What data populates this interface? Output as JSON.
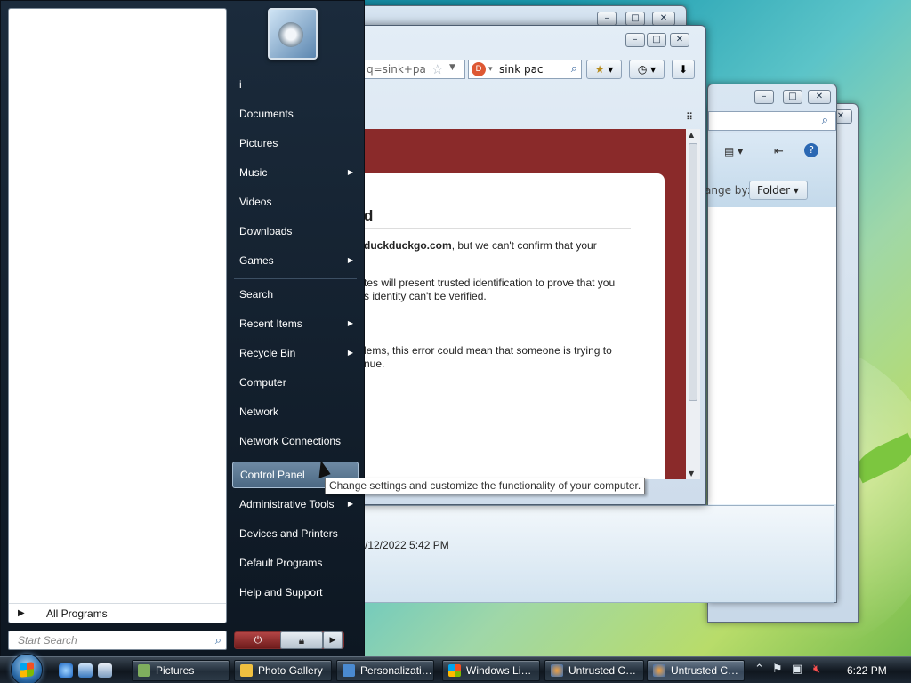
{
  "browser": {
    "address_fragment": "q=sink+pa",
    "search_text": "sink pac",
    "error": {
      "heading": "d",
      "line1_bold": "duckduckgo.com",
      "line1_rest": ", but we can't confirm that your",
      "line2": "tes will present trusted identification to prove that you",
      "line3": "s identity can't be verified.",
      "line4": "lems, this error could mean that someone is trying to",
      "line5": "nue."
    }
  },
  "folder_window": {
    "arrange_by_label": "ange by:",
    "arrange_by_value": "Folder",
    "date_modified": "/12/2022 5:42 PM"
  },
  "start_menu": {
    "user_letter": "i",
    "right_items": [
      {
        "label": "Documents"
      },
      {
        "label": "Pictures"
      },
      {
        "label": "Music"
      },
      {
        "label": "Videos"
      },
      {
        "label": "Downloads"
      },
      {
        "label": "Games"
      },
      {
        "label": "Search"
      },
      {
        "label": "Recent Items"
      },
      {
        "label": "Recycle Bin"
      },
      {
        "label": "Computer"
      },
      {
        "label": "Network"
      },
      {
        "label": "Network Connections"
      },
      {
        "label": "Control Panel"
      },
      {
        "label": "Administrative Tools"
      },
      {
        "label": "Devices and Printers"
      },
      {
        "label": "Default Programs"
      },
      {
        "label": "Help and Support"
      }
    ],
    "all_programs": "All Programs",
    "search_placeholder": "Start Search"
  },
  "tooltip": "Change settings and customize the functionality of your computer.",
  "taskbar": {
    "tasks": [
      {
        "label": "Pictures",
        "icon": "folder-icon",
        "color": "#7fae5e"
      },
      {
        "label": "Photo Gallery",
        "icon": "photo-gallery-icon",
        "color": "#f0c040"
      },
      {
        "label": "Personalizati…",
        "icon": "personalization-icon",
        "color": "#4a8ad0"
      },
      {
        "label": "Windows Li…",
        "icon": "windows-live-icon",
        "color": "#e37b2b"
      },
      {
        "label": "Untrusted C…",
        "icon": "firefox-icon",
        "color": "#3a6fb5"
      },
      {
        "label": "Untrusted C…",
        "icon": "firefox-icon",
        "color": "#3a6fb5"
      }
    ],
    "clock": "6:22 PM"
  },
  "colors": {
    "start_menu_bg": "#15222f",
    "error_page_bg": "#8a2a2a",
    "hover_item": "#5a7893"
  }
}
